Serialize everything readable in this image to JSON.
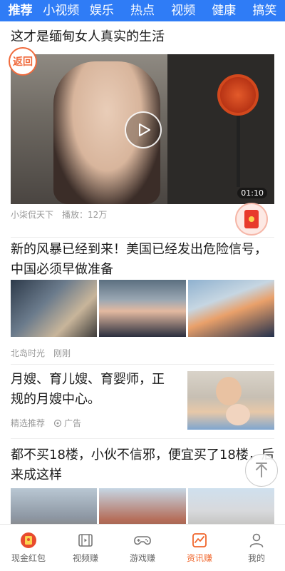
{
  "top_tabs": [
    {
      "label": "推荐",
      "active": true
    },
    {
      "label": "小视频"
    },
    {
      "label": "娱乐"
    },
    {
      "label": "热点"
    },
    {
      "label": "视频"
    },
    {
      "label": "健康"
    },
    {
      "label": "搞笑"
    }
  ],
  "colors": {
    "brand_blue": "#2f7cf6",
    "accent_orange": "#f0662c",
    "red_packet": "#e83a2c"
  },
  "back_button": {
    "label": "返回"
  },
  "feed": [
    {
      "type": "video",
      "title": "这才是缅甸女人真实的生活",
      "duration": "01:10",
      "author": "小柒侃天下",
      "plays": "播放：12万"
    },
    {
      "type": "three_images",
      "title": "新的风暴已经到来！美国已经发出危险信号，中国必须早做准备",
      "author": "北岛时光",
      "time": "刚刚"
    },
    {
      "type": "ad",
      "title": "月嫂、育儿嫂、育婴师，正规的月嫂中心。",
      "source": "精选推荐",
      "ad_label": "广告"
    },
    {
      "type": "three_images",
      "title": "都不买18楼，小伙不信邪，便宜买了18楼，后来成这样"
    }
  ],
  "bottom_nav": [
    {
      "label": "现金红包",
      "icon": "red-packet-icon"
    },
    {
      "label": "视频赚",
      "icon": "film-icon"
    },
    {
      "label": "游戏赚",
      "icon": "gamepad-icon"
    },
    {
      "label": "资讯赚",
      "icon": "news-trend-icon",
      "active": true
    },
    {
      "label": "我的",
      "icon": "user-icon"
    }
  ]
}
